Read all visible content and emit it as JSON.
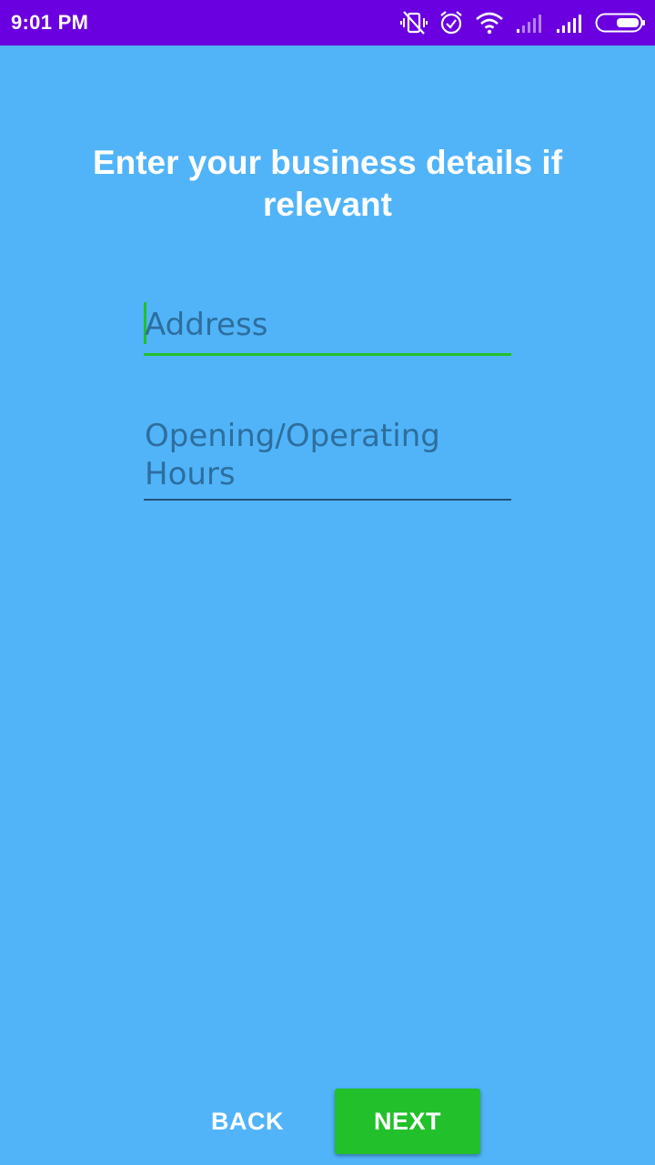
{
  "status_bar": {
    "time": "9:01 PM",
    "icons": [
      "vibrate-off-icon",
      "alarm-icon",
      "wifi-icon",
      "signal-weak-icon",
      "signal-full-icon",
      "battery-icon"
    ],
    "background_color": "#6a00e0"
  },
  "page": {
    "title": "Enter your business details if relevant",
    "background_color": "#51b4f9"
  },
  "form": {
    "address": {
      "placeholder": "Address",
      "value": "",
      "focused": true
    },
    "hours": {
      "placeholder": "Opening/Operating Hours",
      "value": ""
    }
  },
  "buttons": {
    "back_label": "BACK",
    "next_label": "NEXT",
    "accent_color": "#22c02a"
  }
}
